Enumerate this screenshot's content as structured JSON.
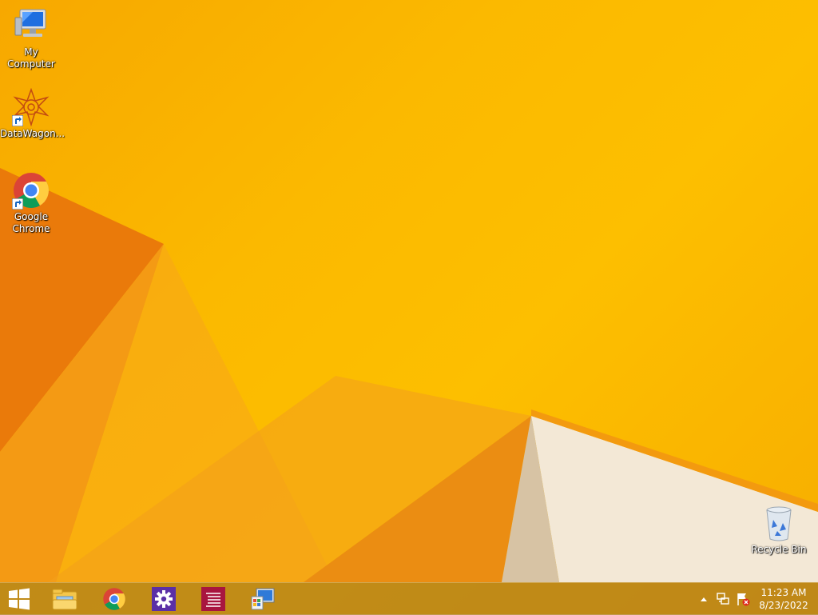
{
  "desktop": {
    "icons": [
      {
        "label": "My Computer",
        "icon": "computer-icon"
      },
      {
        "label": "DataWagon...",
        "icon": "datawagon-icon"
      },
      {
        "label": "Google\nChrome",
        "icon": "chrome-icon"
      },
      {
        "label": "Recycle Bin",
        "icon": "recycle-bin-icon"
      }
    ]
  },
  "taskbar": {
    "start_icon": "windows-logo-icon",
    "pinned": [
      {
        "icon": "file-explorer-icon"
      },
      {
        "icon": "chrome-icon"
      },
      {
        "icon": "settings-gear-icon"
      },
      {
        "icon": "notepad-lines-icon"
      },
      {
        "icon": "control-panel-icon"
      }
    ],
    "tray": {
      "show_hidden_icon": "chevron-up-icon",
      "network_icon": "network-icon",
      "action_center_icon": "flag-error-icon"
    },
    "clock": {
      "time": "11:23 AM",
      "date": "8/23/2022"
    }
  }
}
